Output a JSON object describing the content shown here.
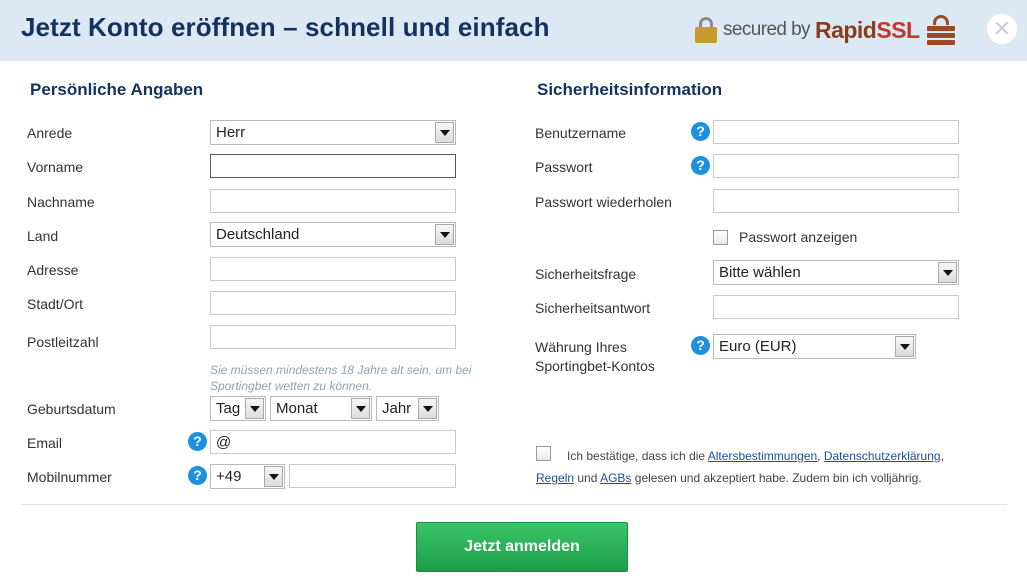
{
  "header": {
    "title": "Jetzt Konto eröffnen – schnell und einfach",
    "ssl_prefix": "secured by",
    "ssl_brand_main": "Rapid",
    "ssl_brand_accent": "SSL",
    "close_icon": "close-icon"
  },
  "personal": {
    "title": "Persönliche Angaben",
    "salutation_label": "Anrede",
    "salutation_value": "Herr",
    "firstname_label": "Vorname",
    "firstname_value": "",
    "lastname_label": "Nachname",
    "lastname_value": "",
    "country_label": "Land",
    "country_value": "Deutschland",
    "address_label": "Adresse",
    "address_value": "",
    "city_label": "Stadt/Ort",
    "city_value": "",
    "zip_label": "Postleitzahl",
    "zip_value": "",
    "age_hint": "Sie müssen mindestens 18 Jahre alt sein, um bei Sportingbet wetten zu können.",
    "birthdate_label": "Geburtsdatum",
    "birth_day": "Tag",
    "birth_month": "Monat",
    "birth_year": "Jahr",
    "email_label": "Email",
    "email_value": "@",
    "mobile_label": "Mobilnummer",
    "mobile_prefix": "+49",
    "mobile_value": ""
  },
  "security": {
    "title": "Sicherheitsinformation",
    "username_label": "Benutzername",
    "username_value": "",
    "password_label": "Passwort",
    "password_value": "",
    "password_repeat_label": "Passwort wiederholen",
    "password_repeat_value": "",
    "show_password_label": "Passwort anzeigen",
    "question_label": "Sicherheitsfrage",
    "question_value": "Bitte wählen",
    "answer_label": "Sicherheitsantwort",
    "answer_value": "",
    "currency_label_line1": "Währung Ihres",
    "currency_label_line2": "Sportingbet-Kontos",
    "currency_value": "Euro (EUR)"
  },
  "terms": {
    "text_1": "Ich bestätige, dass ich die",
    "link_age": "Altersbestimmungen",
    "sep_1": ",",
    "link_privacy": "Datenschutzerklärung",
    "sep_2": ",",
    "link_rules": "Regeln",
    "text_and": "und",
    "link_agb": "AGBs",
    "text_2": "gelesen und akzeptiert habe. Zudem bin ich volljährig."
  },
  "submit_label": "Jetzt anmelden",
  "colors": {
    "header_bg": "#dce9f4",
    "title": "#15315e",
    "help_icon": "#1e90e0",
    "submit": "#22a84f",
    "link": "#1a4f9c"
  }
}
